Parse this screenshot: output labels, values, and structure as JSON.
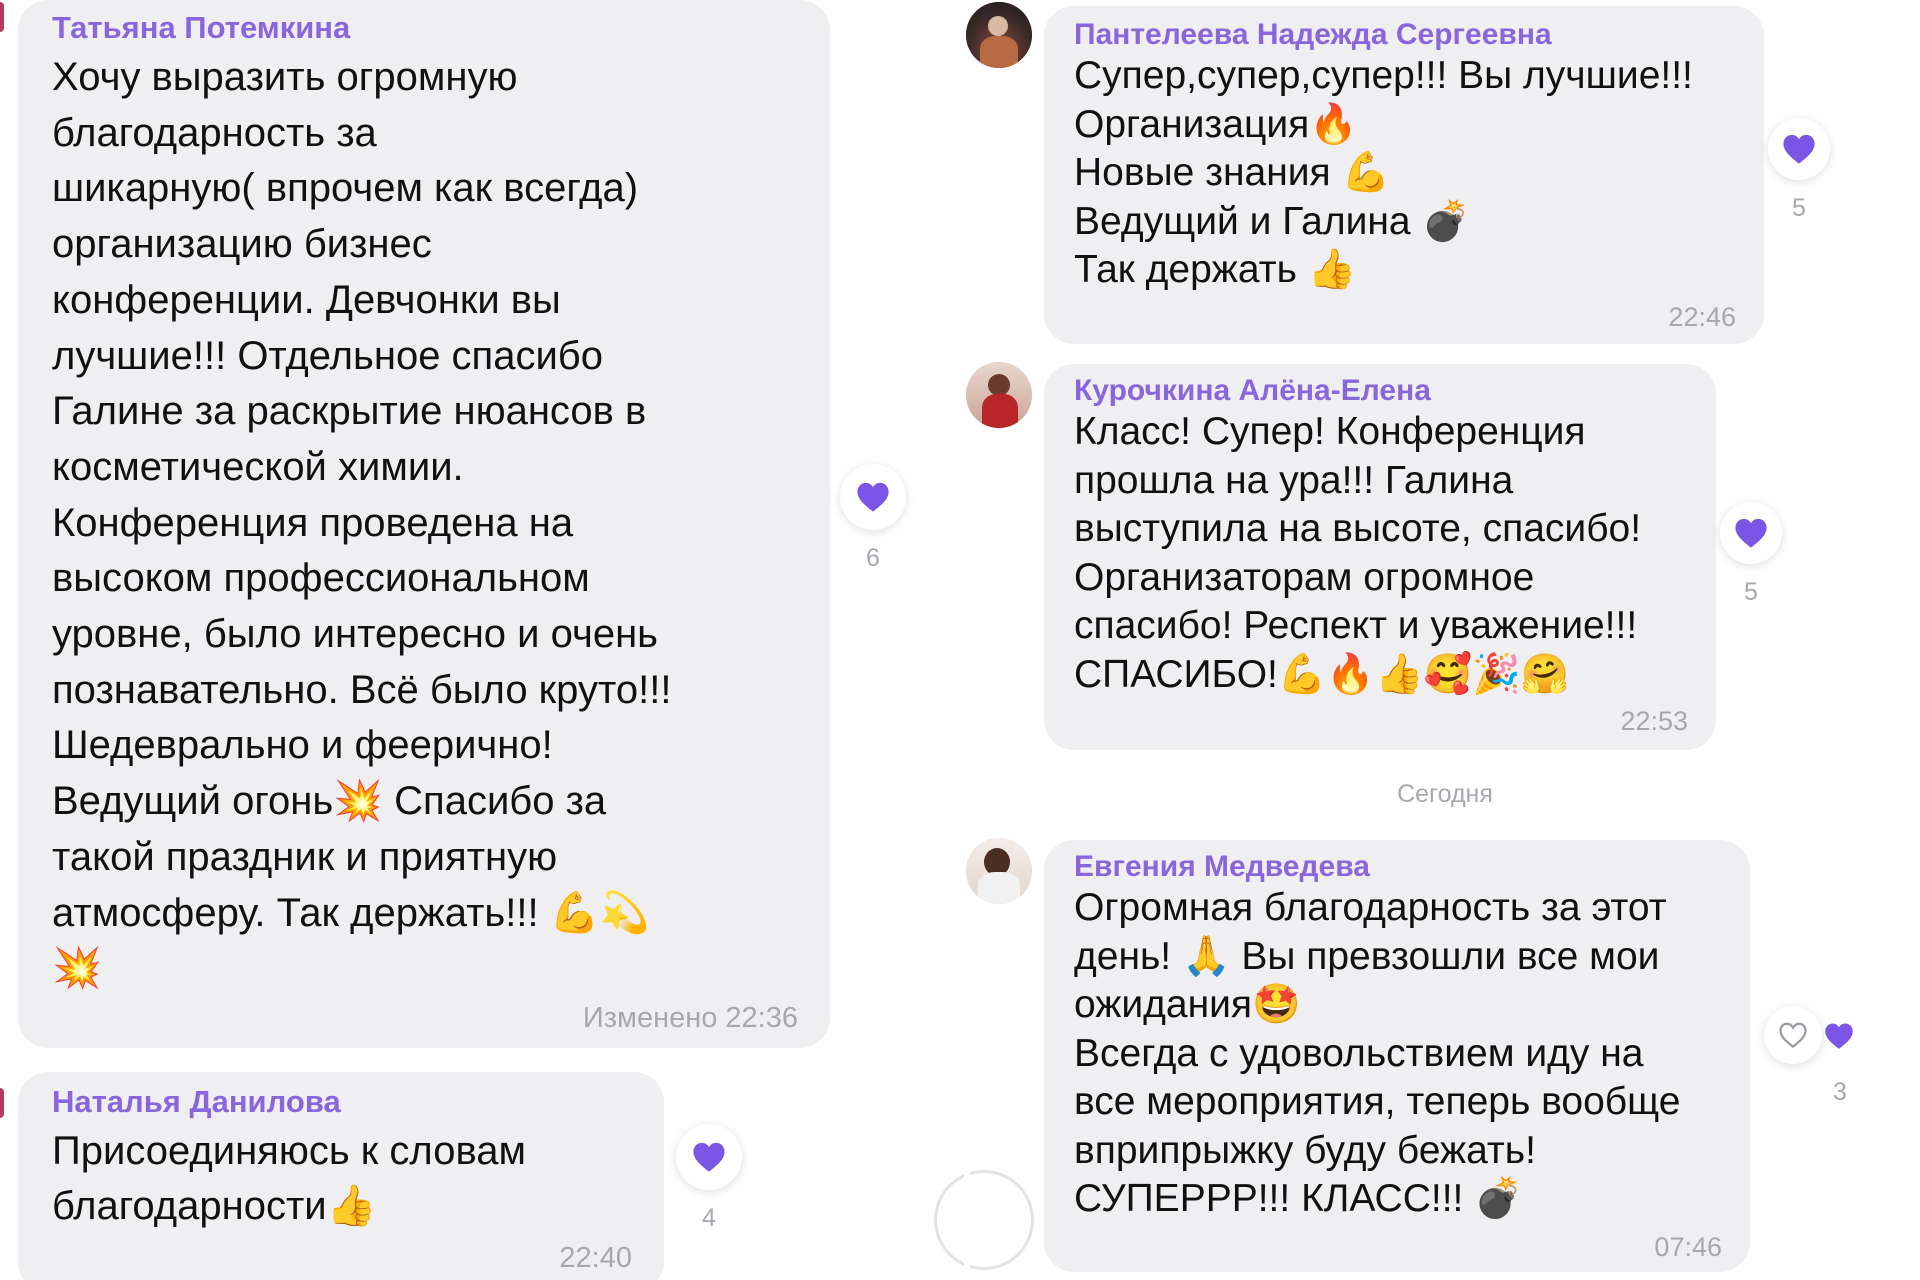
{
  "day_separator": "Сегодня",
  "messages": [
    {
      "sender": "Татьяна Потемкина",
      "text": "Хочу выразить огромную\nблагодарность за\nшикарную( впрочем как всегда)\nорганизацию бизнес\nконференции. Девчонки вы\nлучшие!!! Отдельное спасибо\nГалине за раскрытие нюансов в\nкосметической химии.\nКонференция проведена на\nвысоком профессиональном\nуровне, было интересно и очень\nпознавательно. Всё было круто!!!\nШедеврально и феерично!\nВедущий огонь💥 Спасибо за\nтакой праздник и приятную\nатмосферу. Так держать!!! 💪💫\n💥",
      "time": "Изменено  22:36",
      "reaction_count": "6"
    },
    {
      "sender": "Наталья Данилова",
      "text": "Присоединяюсь к словам\nблагодарности👍",
      "time": "22:40",
      "reaction_count": "4"
    },
    {
      "sender": "Пантелеева Надежда Сергеевна",
      "text": "Супер,супер,супер!!! Вы лучшие!!!\nОрганизация🔥\nНовые знания 💪\nВедущий и Галина 💣\nТак держать 👍",
      "time": "22:46",
      "reaction_count": "5"
    },
    {
      "sender": "Курочкина Алёна-Елена",
      "text": "Класс! Супер! Конференция\nпрошла на ура!!! Галина\nвыступила на высоте, спасибо!\nОрганизаторам огромное\nспасибо! Респект и уважение!!!\nСПАСИБО!💪🔥👍🥰🎉🤗",
      "time": "22:53",
      "reaction_count": "5"
    },
    {
      "sender": "Евгения Медведева",
      "text": "Огромная благодарность за этот\nдень! 🙏 Вы превзошли все мои\nожидания🤩\nВсегда с удовольствием иду на\nвсе мероприятия, теперь вообще\nвприпрыжку буду бежать!\nСУПЕРРР!!! КЛАСС!!! 💣",
      "time": "07:46",
      "reaction_count": "3"
    }
  ],
  "colors": {
    "bubble": "#efeff2",
    "sender_name": "#8a66dc",
    "heart": "#7b55e6",
    "muted_text": "#a7a7ad"
  },
  "icons": [
    "heart-icon",
    "heart-outline-icon",
    "avatar"
  ]
}
